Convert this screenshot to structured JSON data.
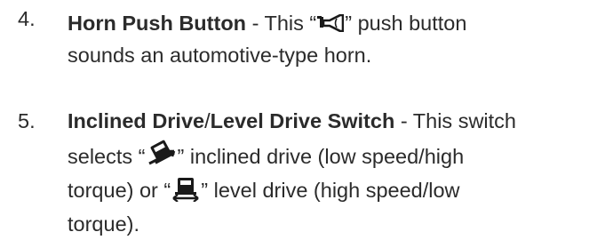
{
  "items": [
    {
      "number": "4.",
      "title": "Horn Push Button",
      "lines": [
        [
          "- This “",
          "” push button"
        ],
        [
          "sounds an automotive-type horn."
        ]
      ],
      "icons": [
        "horn-icon"
      ]
    },
    {
      "number": "5.",
      "title_a": "Inclined Drive",
      "slash": "/",
      "title_b": "Level Drive Switch",
      "lines": [
        [
          "- This switch"
        ],
        [
          "selects “",
          "” inclined drive (low speed/high"
        ],
        [
          "torque) or “",
          "” level drive (high speed/low"
        ],
        [
          "torque)."
        ]
      ],
      "icons": [
        "inclined-drive-icon",
        "level-drive-icon"
      ]
    }
  ],
  "colors": {
    "text": "#2b2b2b",
    "icon": "#1a1a1a"
  }
}
